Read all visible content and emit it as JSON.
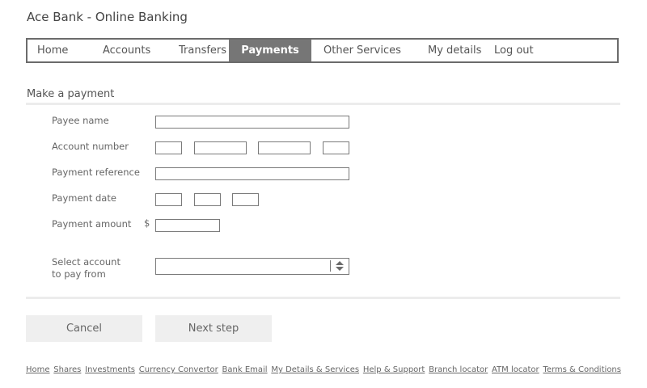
{
  "app": {
    "title": "Ace Bank - Online Banking"
  },
  "nav": {
    "items": [
      {
        "label": "Home"
      },
      {
        "label": "Accounts"
      },
      {
        "label": "Transfers"
      },
      {
        "label": "Payments",
        "active": true
      },
      {
        "label": "Other Services"
      },
      {
        "label": "My details"
      },
      {
        "label": "Log out"
      }
    ]
  },
  "form": {
    "title": "Make a payment",
    "payee_label": "Payee name",
    "account_number_label": "Account number",
    "reference_label": "Payment reference",
    "date_label": "Payment date",
    "amount_label": "Payment amount",
    "currency_symbol": "$",
    "select_account_label_line1": "Select account",
    "select_account_label_line2": "to pay from",
    "payee_value": "",
    "reference_value": "",
    "amount_value": ""
  },
  "buttons": {
    "cancel": "Cancel",
    "next": "Next step"
  },
  "footer": {
    "links": [
      "Home",
      "Shares",
      "Investments",
      "Currency Convertor",
      "Bank Email",
      "My Details & Services",
      "Help & Support",
      "Branch locator",
      "ATM locator",
      "Terms & Conditions"
    ]
  },
  "colors": {
    "nav_active_bg": "#767676",
    "border": "#7a7a7a",
    "button_bg": "#efefef"
  }
}
